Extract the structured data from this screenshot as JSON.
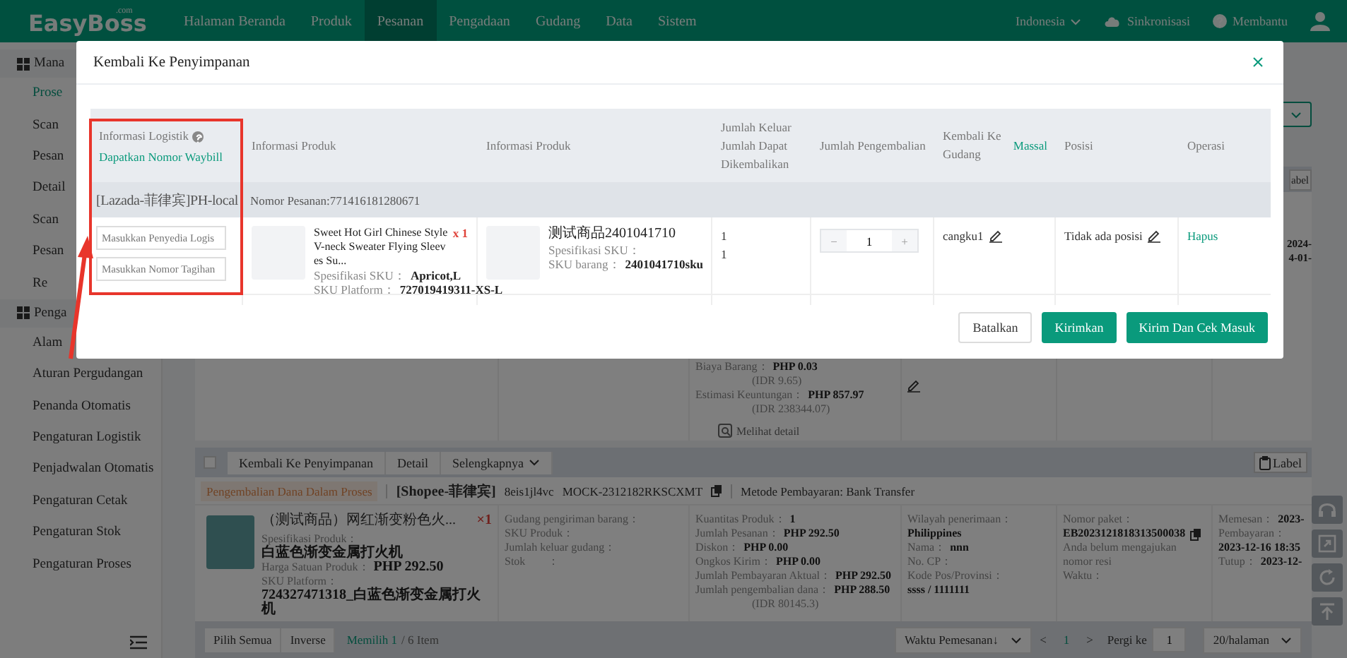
{
  "top_nav": {
    "logo": "EasyBoss",
    "logo_domain": ".com",
    "items": [
      {
        "label": "Halaman Beranda",
        "selected": false
      },
      {
        "label": "Produk",
        "selected": false
      },
      {
        "label": "Pesanan",
        "selected": true
      },
      {
        "label": "Pengadaan",
        "selected": false
      },
      {
        "label": "Gudang",
        "selected": false
      },
      {
        "label": "Data",
        "selected": false
      },
      {
        "label": "Sistem",
        "selected": false
      }
    ],
    "language": "Indonesia",
    "sync": "Sinkronisasi",
    "help": "Membantu"
  },
  "sidebar": {
    "groups": [
      {
        "title": "Mana",
        "items": [
          {
            "label": "Prose",
            "selected": true
          },
          {
            "label": "Scan",
            "selected": false
          },
          {
            "label": "Pesan",
            "selected": false
          },
          {
            "label": "Detail",
            "selected": false
          },
          {
            "label": "Scan",
            "selected": false
          },
          {
            "label": "Pesan",
            "selected": false
          },
          {
            "label": "Re",
            "selected": false
          }
        ]
      },
      {
        "title": "Penga",
        "items": [
          {
            "label": "Alam",
            "selected": false
          },
          {
            "label": "Aturan Pergudangan",
            "selected": false
          },
          {
            "label": "Penanda Otomatis",
            "selected": false
          },
          {
            "label": "Pengaturan Logistik",
            "selected": false
          },
          {
            "label": "Penjadwalan Otomatis",
            "selected": false
          },
          {
            "label": "Pengaturan Cetak",
            "selected": false
          },
          {
            "label": "Pengaturan Stok",
            "selected": false
          },
          {
            "label": "Pengaturan Proses",
            "selected": false
          }
        ]
      }
    ]
  },
  "previous_order": {
    "label_button": "abel",
    "amounts": [
      {
        "label": "Biaya Barang：",
        "value": "PHP 0.03"
      },
      {
        "note": "(IDR 9.65)"
      },
      {
        "label": "Estimasi Keuntungan：",
        "value": "PHP 857.97"
      },
      {
        "note": "(IDR 238344.07)"
      }
    ],
    "detail_link": "Melihat detail",
    "times": [
      "2024-",
      "4-01-"
    ]
  },
  "order": {
    "checked": false,
    "actions": [
      "Kembali Ke Penyimpanan",
      "Detail",
      "Selengkapnya"
    ],
    "label_button": "Label",
    "status": "Pengembalian Dana Dalam Proses",
    "shop": "[Shopee-菲律宾]",
    "buyer": "8eis1jl4vc",
    "order_no": "MOCK-2312182RKSCXMT",
    "payment": "Metode Pembayaran: Bank Transfer",
    "product": {
      "title": "（测试商品）网红渐变粉色火...",
      "qty": "×1",
      "lines": [
        {
          "label": "Spesifikasi Produk："
        },
        {
          "value": "白蓝色渐变金属打火机"
        },
        {
          "label": "Harga Satuan Produk：",
          "value": "PHP 292.50"
        },
        {
          "label": "SKU Platform："
        },
        {
          "value": "724327471318_白蓝色渐变金属打火机"
        }
      ]
    },
    "warehouse": [
      {
        "label": "Gudang pengiriman barang："
      },
      {
        "label": "SKU Produk："
      },
      {
        "label": "Jumlah keluar gudang："
      },
      {
        "label": "Stok　　："
      }
    ],
    "amounts": [
      {
        "label": "Kuantitas Produk：",
        "value": "1"
      },
      {
        "label": "Jumlah Pesanan：",
        "value": "PHP 292.50"
      },
      {
        "label": "Diskon：",
        "value": "PHP 0.00"
      },
      {
        "label": "Ongkos Kirim：",
        "value": "PHP 0.00"
      },
      {
        "label": "Jumlah Pembayaran Aktual：",
        "value": "PHP 292.50"
      },
      {
        "label": "Jumlah pengembalian dana：",
        "value": "PHP 288.50"
      },
      {
        "note": "(IDR 80145.3)"
      }
    ],
    "address": [
      {
        "label": "Wilayah penerimaan："
      },
      {
        "value": "Philippines"
      },
      {
        "label": "Nama：",
        "value": "nnn"
      },
      {
        "label": "No. CP："
      },
      {
        "label": "Kode Pos/Provinsi："
      },
      {
        "value": "ssss / 1111111"
      }
    ],
    "package": {
      "title": "Nomor paket：",
      "number": "EB2023121818313500038",
      "note": "Anda belum mengajukan nomor resi",
      "time_label": "Waktu："
    },
    "times": [
      {
        "label": "Memesan：",
        "value": "2023-"
      },
      {
        "label": "Pembayaran："
      },
      {
        "value": "2023-12-16 18:35"
      },
      {
        "label": "Tutup：",
        "value": "2023-12-"
      }
    ]
  },
  "list_footer": {
    "select_all": "Pilih Semua",
    "inverse": "Inverse",
    "selected_count": "Memilih 1",
    "total": "/ 6 Item",
    "sort": "Waktu Pemesanan↓",
    "prev": "<",
    "page": "1",
    "next": ">",
    "goto": "Pergi ke",
    "goto_value": "1",
    "page_size": "20/halaman"
  },
  "modal": {
    "title": "Kembali Ke Penyimpanan",
    "headers": {
      "logistics": "Informasi Logistik",
      "waybill_link": "Dapatkan Nomor Waybill",
      "product": "Informasi Produk",
      "item": "Informasi Produk",
      "qty_out": "Jumlah Keluar",
      "qty_returnable": "Jumlah Dapat Dikembalikan",
      "return_qty": "Jumlah Pengembalian",
      "warehouse": "Kembali Ke Gudang",
      "bulk_link": "Massal",
      "position": "Posisi",
      "operation": "Operasi"
    },
    "group": {
      "shop": "[Lazada-菲律宾]PH-local",
      "order_no": "Nomor Pesanan:771416181280671"
    },
    "rows": [
      {
        "provider_placeholder": "Masukkan Penyedia Logis",
        "bill_placeholder": "Masukkan Nomor Tagihan",
        "product": {
          "title": "Sweet Hot Girl Chinese Style V-neck Sweater Flying Sleeves Su...",
          "qty": "x 1",
          "spec_label": "Spesifikasi SKU：",
          "spec": "Apricot,L",
          "sku_label": "SKU Platform：",
          "sku": "727019419311-XS-L"
        },
        "item": {
          "title": "测试商品2401041710",
          "spec_label": "Spesifikasi SKU：",
          "sku_label": "SKU barang：",
          "sku": "2401041710sku"
        },
        "qty_out": "1",
        "qty_returnable": "1",
        "minus": "−",
        "return_qty": "1",
        "plus": "+",
        "warehouse": "cangku1",
        "position": "Tidak ada posisi",
        "action": "Hapus"
      }
    ],
    "buttons": [
      {
        "label": "Batalkan",
        "kind": "secondary"
      },
      {
        "label": "Kirimkan",
        "kind": "primary"
      },
      {
        "label": "Kirim Dan Cek Masuk",
        "kind": "primary"
      }
    ]
  }
}
